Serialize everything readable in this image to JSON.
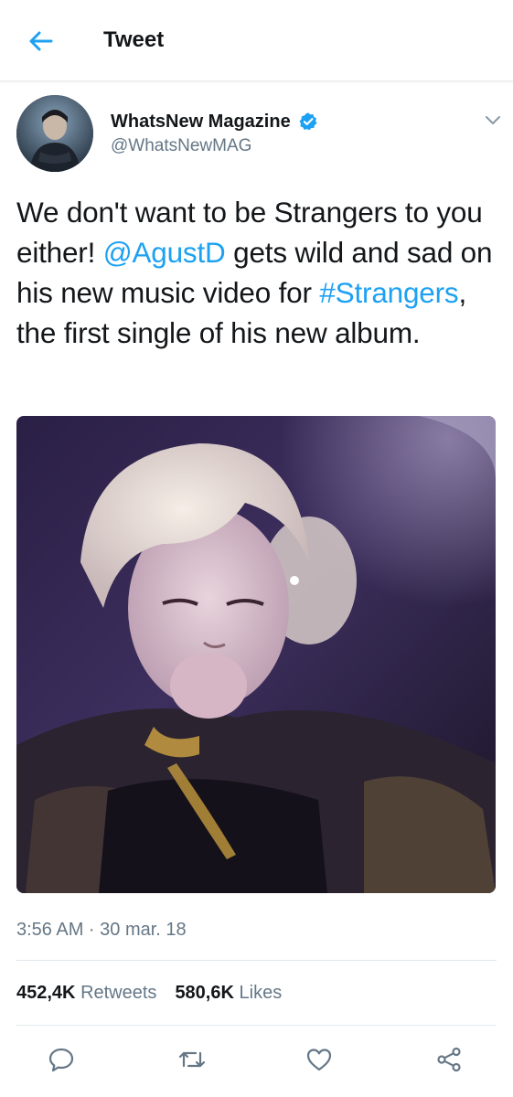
{
  "header": {
    "title": "Tweet"
  },
  "tweet": {
    "author": {
      "display_name": "WhatsNew Magazine",
      "handle": "@WhatsNewMAG",
      "verified": true
    },
    "text_parts": {
      "p1": "We don't want to be Strangers to you either! ",
      "mention": "@AgustD",
      "p2": " gets wild and sad on his new music video for ",
      "hashtag": "#Strangers",
      "p3": ", the first single of his new album."
    },
    "timestamp": "3:56 AM · 30 mar. 18",
    "stats": {
      "retweets_count": "452,4K",
      "retweets_label": "Retweets",
      "likes_count": "580,6K",
      "likes_label": "Likes"
    }
  },
  "colors": {
    "accent": "#1da1f2",
    "secondary_text": "#657786",
    "divider": "#e1e8ed"
  },
  "icons": [
    "back-arrow-icon",
    "verified-badge-icon",
    "chevron-down-icon",
    "reply-icon",
    "retweet-icon",
    "like-icon",
    "share-icon"
  ]
}
